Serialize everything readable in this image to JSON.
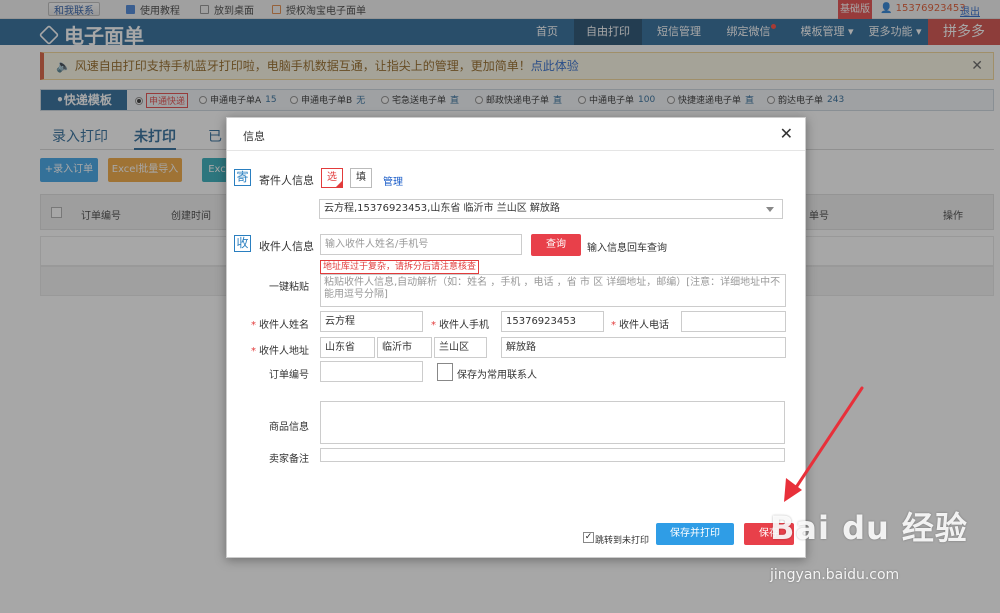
{
  "topbar": {
    "contact_label": "和我联系",
    "tutorial_label": "使用教程",
    "desktop_label": "放到桌面",
    "auth_label": "授权淘宝电子面单",
    "plan_badge": "基础版",
    "user_phone": "15376923453",
    "logout_label": "退出"
  },
  "navbar": {
    "logo_text": "电子面单",
    "items": [
      {
        "label": "首页"
      },
      {
        "label": "自由打印"
      },
      {
        "label": "短信管理"
      },
      {
        "label": "绑定微信"
      },
      {
        "label": "模板管理 ▾"
      },
      {
        "label": "更多功能 ▾"
      }
    ],
    "pdd_label": "拼多多"
  },
  "notice": {
    "text": "风速自由打印支持手机蓝牙打印啦，电脑手机数据互通，让指尖上的管理，更加简单！",
    "link_label": "点此体验",
    "close": "✕"
  },
  "template_bar": {
    "title": "•快递模板",
    "options": [
      {
        "label": "申通快递",
        "count": ""
      },
      {
        "label": "申通电子单A",
        "count": "15"
      },
      {
        "label": "申通电子单B",
        "count": "无"
      },
      {
        "label": "宅急送电子单",
        "count": "直"
      },
      {
        "label": "邮政快递电子单",
        "count": "直"
      },
      {
        "label": "中通电子单",
        "count": "100"
      },
      {
        "label": "快捷速递电子单",
        "count": "直"
      },
      {
        "label": "韵达电子单",
        "count": "243"
      }
    ]
  },
  "tabs": [
    {
      "label": "录入打印"
    },
    {
      "label": "未打印"
    },
    {
      "label": "已"
    }
  ],
  "actions": {
    "add_order": "+录入订单",
    "excel_import": "Excel批量导入",
    "excel_short": "Exc"
  },
  "table": {
    "headers": [
      "订单编号",
      "创建时间",
      "单号",
      "操作"
    ]
  },
  "modal": {
    "title": "信息",
    "close": "✕",
    "sender": {
      "icon": "寄",
      "label": "寄件人信息",
      "opt_select": "选",
      "opt_fill": "填",
      "manage": "管理",
      "selected": "云方程,15376923453,山东省 临沂市 兰山区 解放路"
    },
    "receiver": {
      "icon": "收",
      "label": "收件人信息",
      "search_placeholder": "输入收件人姓名/手机号",
      "query_btn": "查询",
      "query_hint": "输入信息回车查询",
      "warning": "地址库过于复杂，请拆分后请注意核查"
    },
    "paste": {
      "label": "一键粘贴",
      "placeholder": "粘贴收件人信息,自动解析（如：姓名 ，手机 ，电话 ，省 市 区 详细地址，邮编）[注意：详细地址中不能用逗号分隔]"
    },
    "fields": {
      "name_label": "收件人姓名",
      "name_value": "云方程",
      "mobile_label": "收件人手机",
      "mobile_value": "15376923453",
      "phone_label": "收件人电话",
      "phone_value": "",
      "address_label": "收件人地址",
      "province": "山东省",
      "city": "临沂市",
      "district": "兰山区",
      "street": "解放路",
      "order_label": "订单编号",
      "order_value": "",
      "save_contact": "保存为常用联系人",
      "goods_label": "商品信息",
      "remark_label": "卖家备注"
    },
    "footer": {
      "jump_label": "跳转到未打印",
      "save_print": "保存并打印",
      "save": "保存"
    }
  },
  "watermark": {
    "brand": "Bai du 经验",
    "url": "jingyan.baidu.com"
  },
  "colors": {
    "nav": "#1b5d91",
    "accent_red": "#e8404a",
    "accent_blue": "#2f9de6"
  }
}
